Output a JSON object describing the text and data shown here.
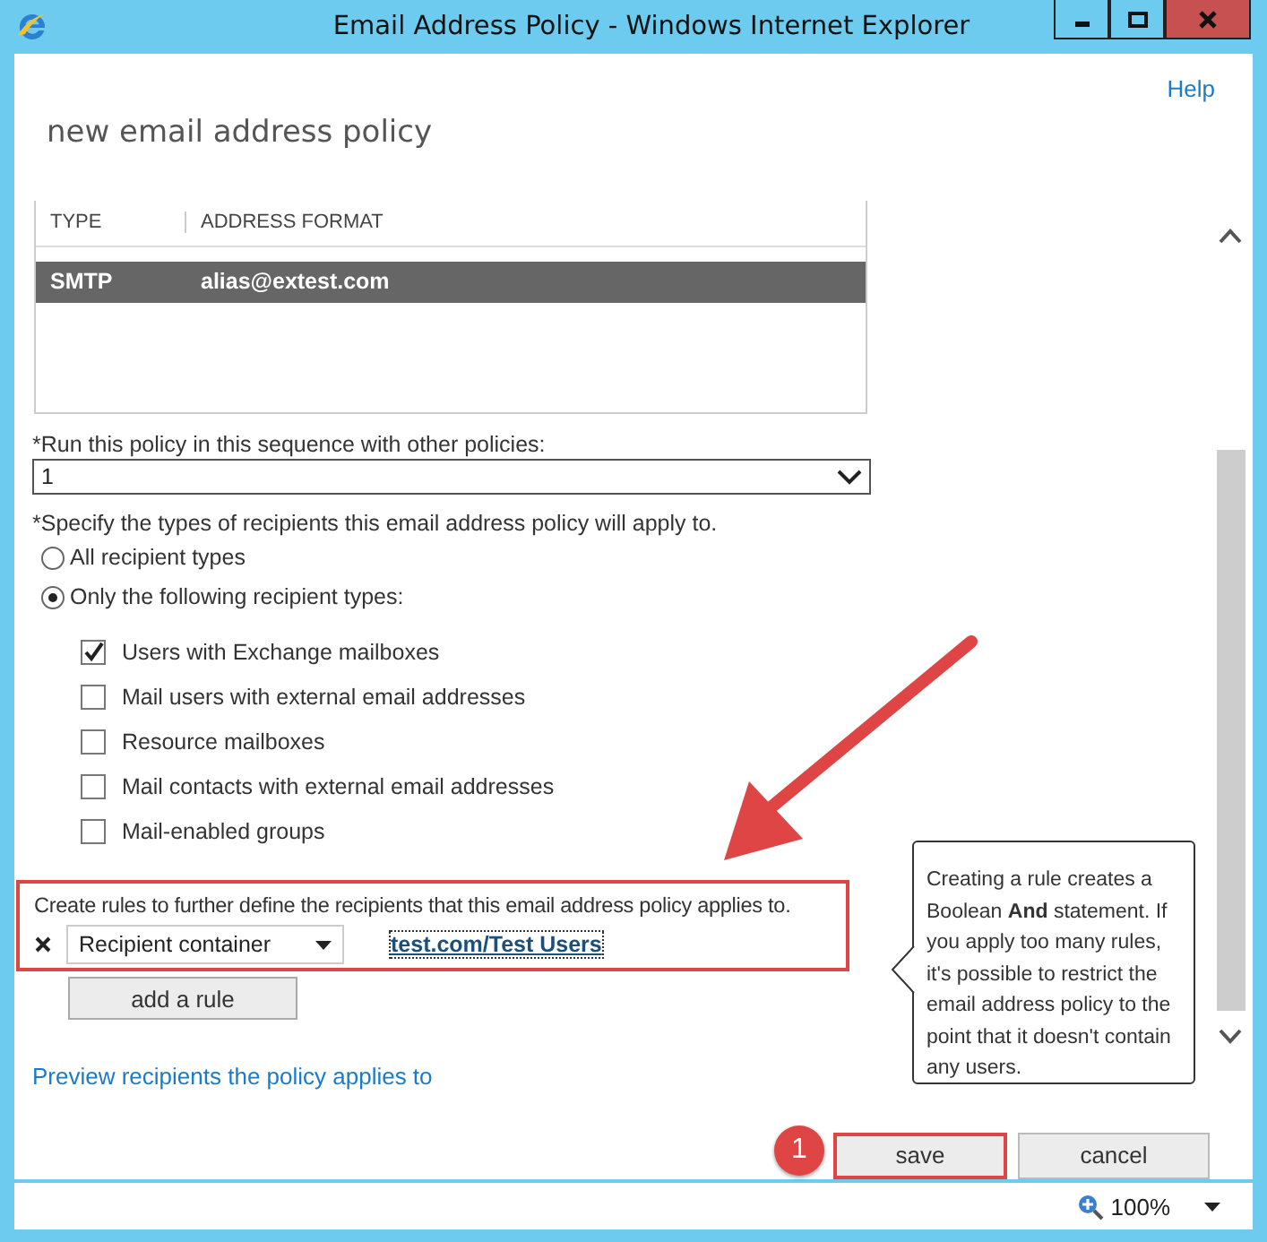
{
  "window": {
    "title": "Email Address Policy - Windows Internet Explorer"
  },
  "help": "Help",
  "heading": "new email address policy",
  "address_table": {
    "columns": [
      "TYPE",
      "ADDRESS FORMAT"
    ],
    "rows": [
      {
        "type": "SMTP",
        "address_format": "alias@extest.com",
        "selected": true
      }
    ]
  },
  "sequence": {
    "label": "*Run this policy in this sequence with other policies:",
    "value": "1"
  },
  "recipients": {
    "label": "*Specify the types of recipients this email address policy will apply to.",
    "options": [
      {
        "label": "All recipient types",
        "selected": false
      },
      {
        "label": "Only the following recipient types:",
        "selected": true
      }
    ],
    "types": [
      {
        "label": "Users with Exchange mailboxes",
        "checked": true
      },
      {
        "label": "Mail users with external email addresses",
        "checked": false
      },
      {
        "label": "Resource mailboxes",
        "checked": false
      },
      {
        "label": "Mail contacts with external email addresses",
        "checked": false
      },
      {
        "label": "Mail-enabled groups",
        "checked": false
      }
    ]
  },
  "rules": {
    "label": "Create rules to further define the recipients that this email address policy applies to.",
    "rows": [
      {
        "condition": "Recipient container",
        "value": "test.com/Test Users"
      }
    ],
    "add_button": "add a rule"
  },
  "preview_link": "Preview recipients the policy applies to",
  "callout": {
    "text": "Creating a rule creates a Boolean **And** statement. If you apply too many rules, it's possible to restrict the email address policy to the point that it doesn't contain any users."
  },
  "buttons": [
    {
      "label": "save",
      "highlighted": true
    },
    {
      "label": "cancel",
      "highlighted": false
    }
  ],
  "step_badge": "1",
  "status_bar": {
    "zoom": "100%"
  }
}
